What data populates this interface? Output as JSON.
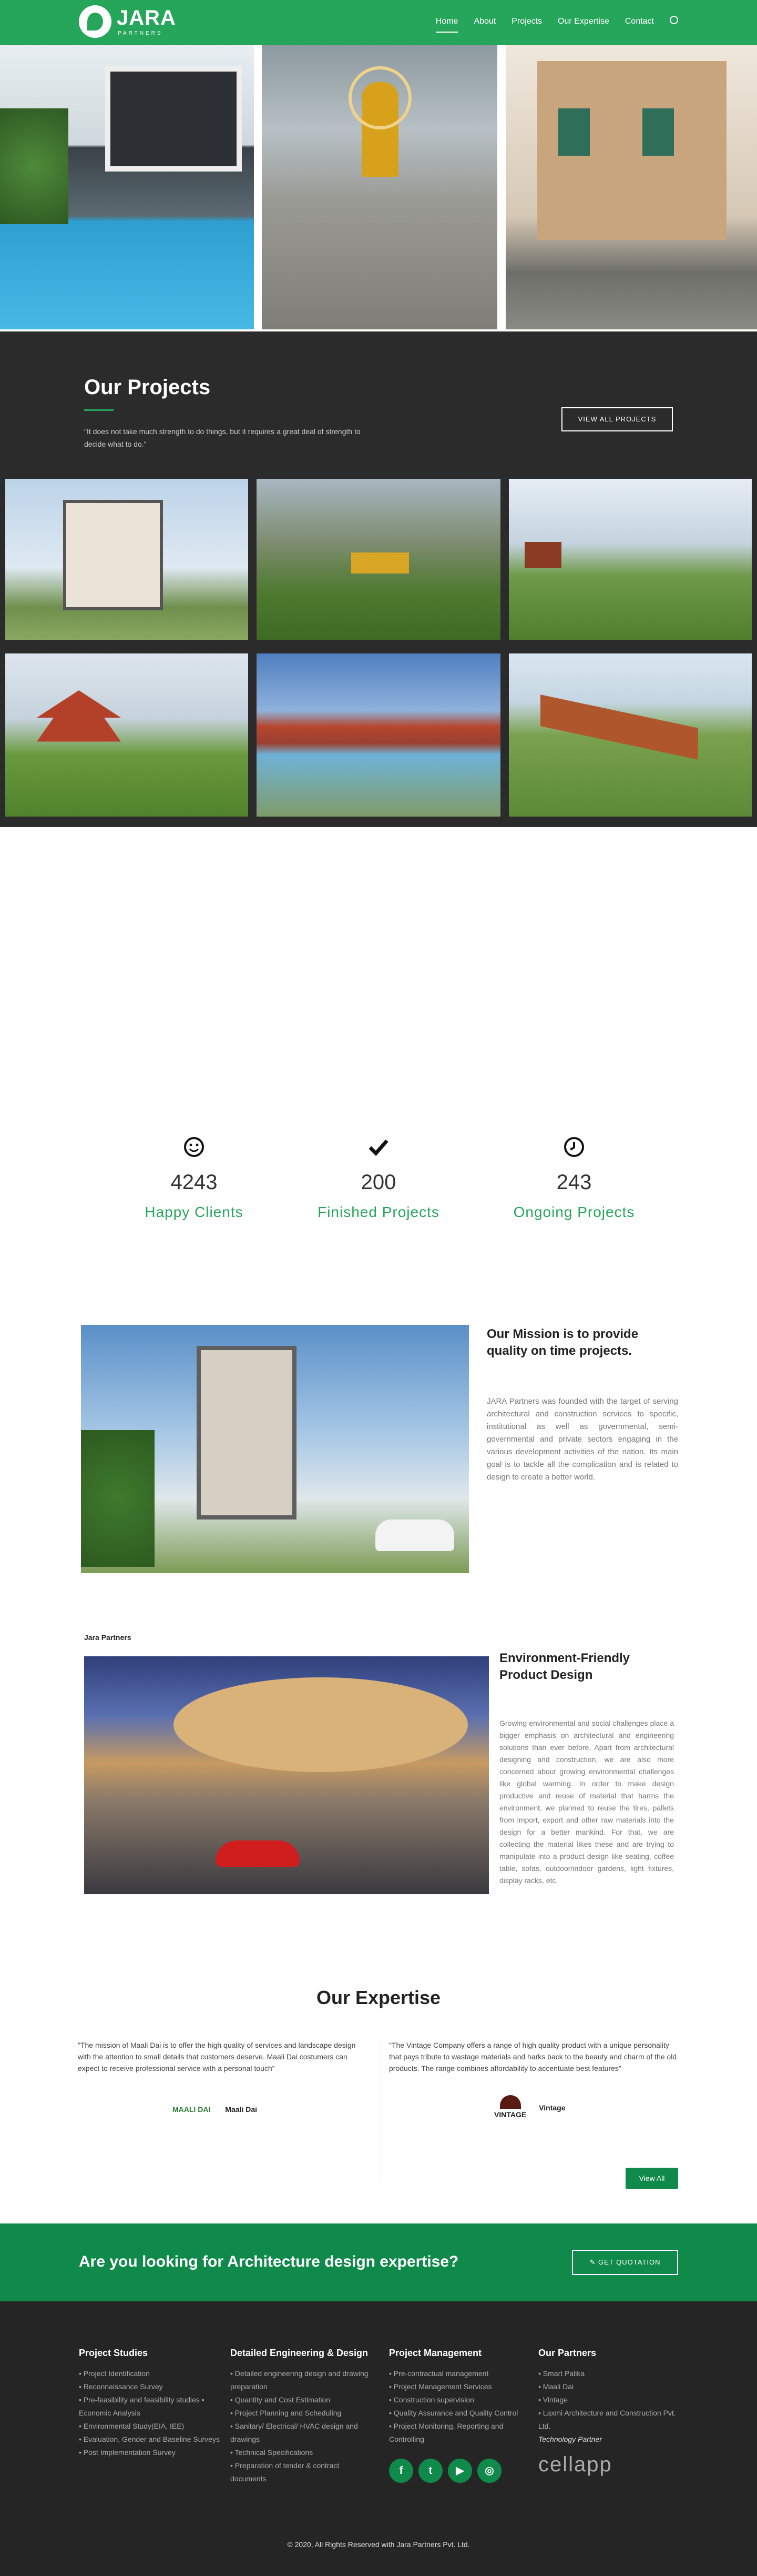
{
  "header": {
    "logo_text": "JARA",
    "logo_sub": "PARTNERS",
    "nav": [
      "Home",
      "About",
      "Projects",
      "Our Expertise",
      "Contact"
    ]
  },
  "projects": {
    "title": "Our Projects",
    "quote": "\"It does not take much strength to do things, but it requires a great deal of strength to decide what to do.\"",
    "button": "VIEW ALL PROJECTS"
  },
  "counters": [
    {
      "icon": "smiley-icon",
      "value": "4243",
      "label": "Happy Clients"
    },
    {
      "icon": "checkmark-icon",
      "value": "200",
      "label": "Finished Projects"
    },
    {
      "icon": "clock-icon",
      "value": "243",
      "label": "Ongoing Projects"
    }
  ],
  "mission": {
    "title": "Our Mission is to provide quality on time projects.",
    "text": "JARA Partners was founded with the target of serving architectural and construction services to specific, institutional as well as governmental, semi-governmental and private sectors engaging in the various development activities of the nation. Its main goal is to tackle all the complication and is related to design to create a better world."
  },
  "eco": {
    "caption": "Jara Partners",
    "title": "Environment-Friendly Product Design",
    "text": "Growing environmental and social challenges place a bigger emphasis on architectural and engineering solutions than ever before. Apart from architectural designing and construction, we are also more concerned about growing environmental challenges like global warming. In order to make design productive and reuse of material that harms the environment, we planned to reuse the tires, pallets from import, export and other raw materials into the design for a better mankind. For that, we are collecting the material likes these and are trying to manipulate into a product design like seating, coffee table, sofas, outdoor/indoor gardens, light fixtures, display racks, etc."
  },
  "expertise": {
    "title": "Our Expertise",
    "cards": [
      {
        "text": "\"The mission of Maali Dai is to offer the high quality of services and landscape design with the attention to small details that customers deserve. Maali Dai costumers can expect to receive professional service with a personal touch\"",
        "logo": "MAALI DAI",
        "name": "Maali Dai"
      },
      {
        "text": "\"The Vintage Company offers a range of high quality product with a unique personality that pays tribute to wastage materials and harks back to the beauty and charm of the old products. The range combines affordability to accentuate best features\"",
        "logo": "VINTAGE",
        "name": "Vintage"
      }
    ],
    "button": "View All"
  },
  "cta": {
    "text": "Are you looking for Architecture design expertise?",
    "button": "GET QUOTATION"
  },
  "footer": {
    "cols": [
      {
        "title": "Project Studies",
        "items": [
          "Project Identification",
          "Reconnaissance Survey",
          "Pre-feasibility and feasibility studies • Economic Analysis",
          "Environmental Study(EIA, IEE)",
          "Evaluation, Gender and Baseline Surveys",
          "Post Implementation Survey"
        ]
      },
      {
        "title": "Detailed Engineering & Design",
        "items": [
          "Detailed engineering design and drawing preparation",
          "Quantity and Cost Estimation",
          "Project Planning and Scheduling",
          "Sanitary/ Electrical/ HVAC design and drawings",
          "Technical Specifications",
          "Preparation of tender & contract documents"
        ]
      },
      {
        "title": "Project Management",
        "items": [
          "Pre-contractual management",
          "Project Management Services",
          "Construction supervision",
          "Quality Assurance and Quality Control",
          "Project Monitoring, Reporting and Controlling"
        ]
      },
      {
        "title": "Our Partners",
        "items": [
          "Smart Palika",
          "Maali Dai",
          "Vintage",
          "Laxmi Architecture and Construction Pvt. Ltd."
        ]
      }
    ],
    "tech_partner": "Technology Partner",
    "tech_logo": "cellapp",
    "social": [
      "facebook-icon",
      "twitter-icon",
      "youtube-icon",
      "instagram-icon"
    ],
    "copyright": "© 2020, All Rights Reserved with Jara Partners Pvt. Ltd."
  }
}
